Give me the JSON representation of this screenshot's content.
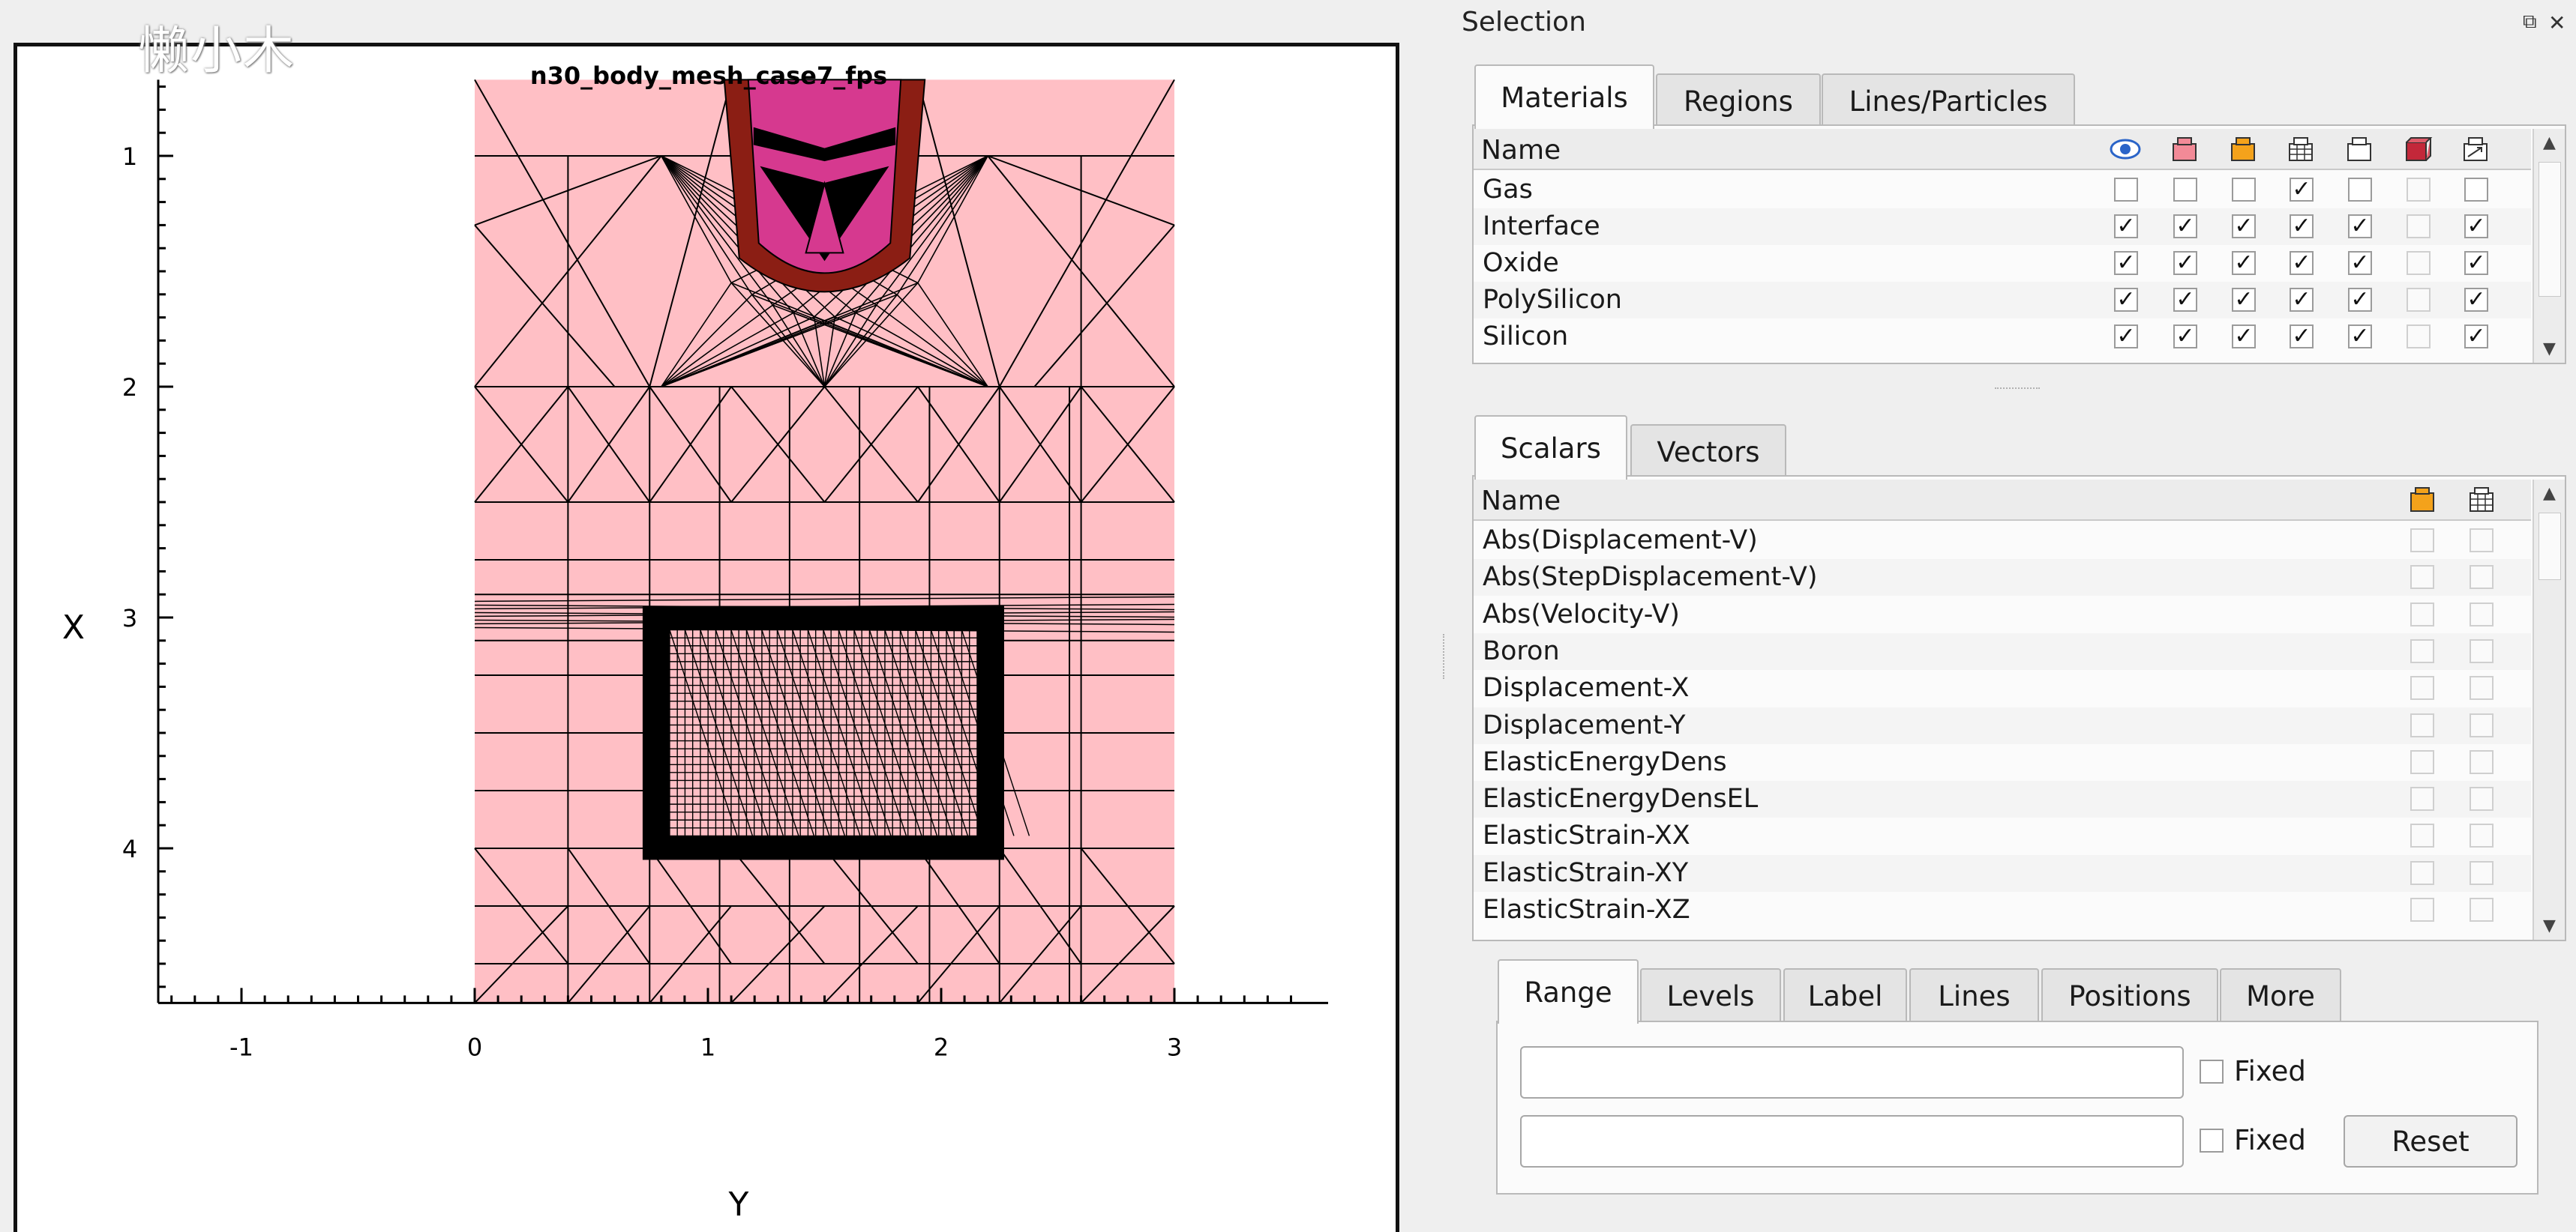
{
  "watermark": "懒小木",
  "plot": {
    "title": "n30_body_mesh_case7_fps",
    "xlabel": "Y",
    "ylabel": "X",
    "x_ticks": [
      "-1",
      "0",
      "1",
      "2",
      "3"
    ],
    "y_ticks": [
      "1",
      "2",
      "3",
      "4"
    ],
    "colors": {
      "silicon": "#ffbfc5",
      "poly": "#d6398f",
      "oxide": "#8b1e14",
      "mesh": "#000000"
    }
  },
  "selection": {
    "title": "Selection",
    "tabs": [
      "Materials",
      "Regions",
      "Lines/Particles"
    ],
    "active_tab": "Materials",
    "header_name": "Name",
    "column_icons": [
      "eye-icon",
      "red-box-icon",
      "orange-box-icon",
      "mesh-box-icon",
      "outline-box-icon",
      "red-solid-box-icon",
      "vector-box-icon"
    ],
    "materials": [
      {
        "name": "Gas",
        "checks": [
          false,
          false,
          false,
          true,
          false,
          false,
          false
        ]
      },
      {
        "name": "Interface",
        "checks": [
          true,
          true,
          true,
          true,
          true,
          false,
          true
        ]
      },
      {
        "name": "Oxide",
        "checks": [
          true,
          true,
          true,
          true,
          true,
          false,
          true
        ]
      },
      {
        "name": "PolySilicon",
        "checks": [
          true,
          true,
          true,
          true,
          true,
          false,
          true
        ]
      },
      {
        "name": "Silicon",
        "checks": [
          true,
          true,
          true,
          true,
          true,
          false,
          true
        ]
      }
    ],
    "check_mark": "✓"
  },
  "fields": {
    "tabs": [
      "Scalars",
      "Vectors"
    ],
    "active_tab": "Scalars",
    "header_name": "Name",
    "scalars": [
      "Abs(Displacement-V)",
      "Abs(StepDisplacement-V)",
      "Abs(Velocity-V)",
      "Boron",
      "Displacement-X",
      "Displacement-Y",
      "ElasticEnergyDens",
      "ElasticEnergyDensEL",
      "ElasticStrain-XX",
      "ElasticStrain-XY",
      "ElasticStrain-XZ"
    ]
  },
  "options": {
    "tabs": [
      "Range",
      "Levels",
      "Label",
      "Lines",
      "Positions",
      "More"
    ],
    "active_tab": "Range",
    "fixed_label": "Fixed",
    "reset_label": "Reset",
    "min_value": "",
    "max_value": ""
  }
}
